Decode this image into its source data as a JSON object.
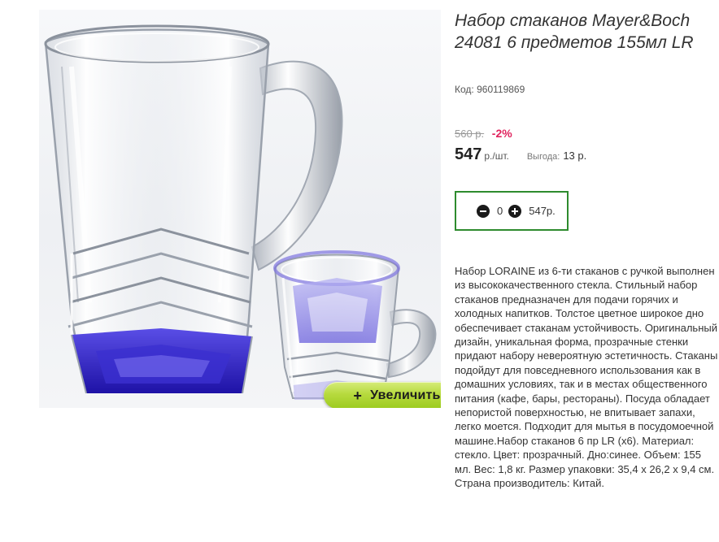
{
  "product": {
    "title": "Набор стаканов Mayer&Boch 24081 6 предметов 155мл LR",
    "code_label": "Код:",
    "code_value": "960119869"
  },
  "pricing": {
    "old_price": "560 р.",
    "discount": "-2%",
    "price": "547",
    "price_unit": "р./шт.",
    "savings_label": "Выгода:",
    "savings_value": "13 р."
  },
  "cart": {
    "quantity": "0",
    "total": "547р."
  },
  "image": {
    "zoom_label": "Увеличить",
    "zoom_icon": "plus-icon"
  },
  "description": "Набор LORAINE из 6-ти стаканов с ручкой выполнен из высококачественного стекла. Стильный набор стаканов предназначен для подачи горячих и холодных напитков. Толстое цветное широкое дно обеспечивает стаканам устойчивость. Оригинальный дизайн, уникальная форма, прозрачные стенки придают набору невероятную эстетичность. Стаканы подойдут для повседневного использования как в домашних условиях, так и в местах общественного питания (кафе, бары, рестораны). Посуда обладает непористой поверхностью, не впитывает запахи, легко моется. Подходит для мытья в посудомоечной машине.Набор стаканов 6 пр LR (х6). Материал: стекло. Цвет: прозрачный. Дно:синее. Объем: 155 мл. Вес: 1,8 кг. Размер упаковки: 35,4 х 26,2 х 9,4 см. Страна производитель: Китай.",
  "colors": {
    "accent_green": "#2e8b2e",
    "discount_red": "#e0245e",
    "zoom_button_green": "#b7da3e",
    "glass_bottom_blue": "#2a1fb8"
  }
}
